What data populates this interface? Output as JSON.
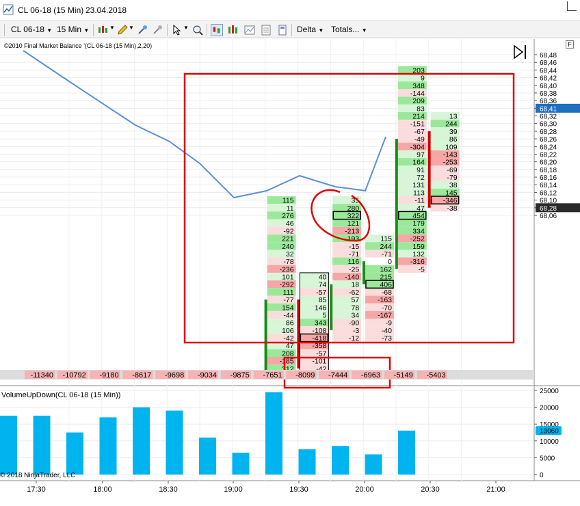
{
  "window": {
    "symbol": "CL 06-18 (15 Min)",
    "date": "23.04.2018"
  },
  "toolbar": {
    "instrument": "CL 06-18",
    "interval": "15 Min",
    "delta_label": "Delta",
    "totals_label": "Totals...",
    "icons": [
      "bar-type-icon",
      "pencil-icon",
      "add-indicator-icon",
      "strategy-icon",
      "cursor-icon",
      "zoom-icon",
      "chart-style-icon",
      "candles-icon",
      "template-icon",
      "properties-icon"
    ]
  },
  "panel_labels": {
    "indicator": "©2010 Final Market Balance  '(CL 06-18 (15 Min),2,20)",
    "volume": "VolumeUpDown(CL 06-18 (15 Min))",
    "copyright": "© 2018 NinjaTrader, LLC",
    "f_key": "F"
  },
  "colors": {
    "pos_bg": "#9be89b",
    "pos_bg_light": "#d8f5d8",
    "neg_bg": "#f5a6a6",
    "neg_bg_light": "#fbdcdc",
    "volume_bar": "#00b4f0",
    "highlight_red": "#e00000",
    "line_blue": "#5b8fd6",
    "price_tag": "#1e6fc0",
    "current_tag": "#2a2a2a"
  },
  "price_axis": {
    "labels": [
      "68,48",
      "68,46",
      "68,44",
      "68,42",
      "68,40",
      "68,38",
      "68,36",
      "68,34",
      "68,32",
      "68,30",
      "68,28",
      "68,26",
      "68,24",
      "68,22",
      "68,20",
      "68,18",
      "68,16",
      "68,14",
      "68,12",
      "68,10",
      "68,08",
      "68,06"
    ],
    "tag_blue": "68,41",
    "tag_dark": "68,28"
  },
  "volume_axis": {
    "labels": [
      "25000",
      "20000",
      "15000",
      "10000",
      "5000",
      "0"
    ],
    "tag": "13060"
  },
  "time_axis": [
    "17:30",
    "18:00",
    "18:30",
    "19:00",
    "19:30",
    "20:00",
    "20:30",
    "21:00"
  ],
  "totals_row": [
    "-11340",
    "-10792",
    "-9180",
    "-8617",
    "-9698",
    "-9034",
    "-9875",
    "-7651",
    "-8099",
    "-7444",
    "-6963",
    "-5149",
    "-5403"
  ],
  "chart_data": {
    "type": "bar",
    "volume_values": [
      17500,
      17500,
      12500,
      17000,
      20000,
      19000,
      11000,
      6500,
      24500,
      7500,
      8500,
      6000,
      13060
    ],
    "line_values": [
      68.47,
      68.45,
      68.43,
      68.4,
      68.37,
      68.33,
      68.29,
      68.3,
      68.32,
      68.305,
      68.3,
      68.38
    ],
    "candle_bodies": [
      {
        "col": 7,
        "open": 68.06,
        "close": 68.16,
        "dir": "up"
      },
      {
        "col": 8,
        "open": 68.16,
        "close": 68.07,
        "dir": "down"
      },
      {
        "col": 9,
        "open": 68.12,
        "close": 68.18,
        "dir": "up"
      },
      {
        "col": 10,
        "open": 68.18,
        "close": 68.21,
        "dir": "up"
      },
      {
        "col": 11,
        "open": 68.2,
        "close": 68.37,
        "dir": "up"
      },
      {
        "col": 12,
        "open": 68.38,
        "close": 68.28,
        "dir": "down"
      }
    ],
    "footprint_columns": [
      {
        "col": 7,
        "top": 68.29,
        "values": [
          115,
          11,
          276,
          46,
          -92,
          221,
          240,
          32,
          -78,
          -236,
          101,
          -292,
          111,
          -77,
          154,
          -44,
          86,
          106,
          -42,
          47,
          208,
          -185,
          312
        ]
      },
      {
        "col": 8,
        "top": 68.19,
        "values": [
          40,
          74,
          -57,
          85,
          146,
          5,
          343,
          -108,
          -418,
          -358,
          -57,
          -101,
          -42
        ]
      },
      {
        "col": 9,
        "top": 68.29,
        "values": [
          35,
          280,
          322,
          121,
          -213,
          193,
          -15,
          -71,
          116,
          -25,
          -140,
          18,
          -62,
          57,
          78,
          34,
          -90,
          -3,
          -12
        ]
      },
      {
        "col": 10,
        "top": 68.24,
        "values": [
          115,
          244,
          -71,
          0,
          162,
          215,
          406,
          -68,
          -163,
          -70,
          -167,
          -9,
          -40,
          -73
        ]
      },
      {
        "col": 11,
        "top": 68.46,
        "values": [
          203,
          9,
          348,
          -144,
          209,
          83,
          214,
          -151,
          -67,
          -49,
          -304,
          97,
          164,
          91,
          72,
          131,
          113,
          -11,
          47,
          454,
          179,
          334,
          -252,
          159,
          132,
          -316,
          -5
        ]
      },
      {
        "col": 12,
        "top": 68.4,
        "values": [
          13,
          244,
          39,
          86,
          109,
          -143,
          -253,
          -69,
          -79,
          38,
          145,
          -346,
          -38
        ]
      }
    ],
    "boxed_cells": [
      {
        "col": 8,
        "value": -418
      },
      {
        "col": 9,
        "value": 322
      },
      {
        "col": 10,
        "value": 406
      },
      {
        "col": 11,
        "value": 454
      },
      {
        "col": 12,
        "value": -346
      }
    ],
    "xlabel": "",
    "ylabel": "",
    "ylim": [
      68.05,
      68.49
    ],
    "volume_ylim": [
      0,
      27000
    ]
  }
}
